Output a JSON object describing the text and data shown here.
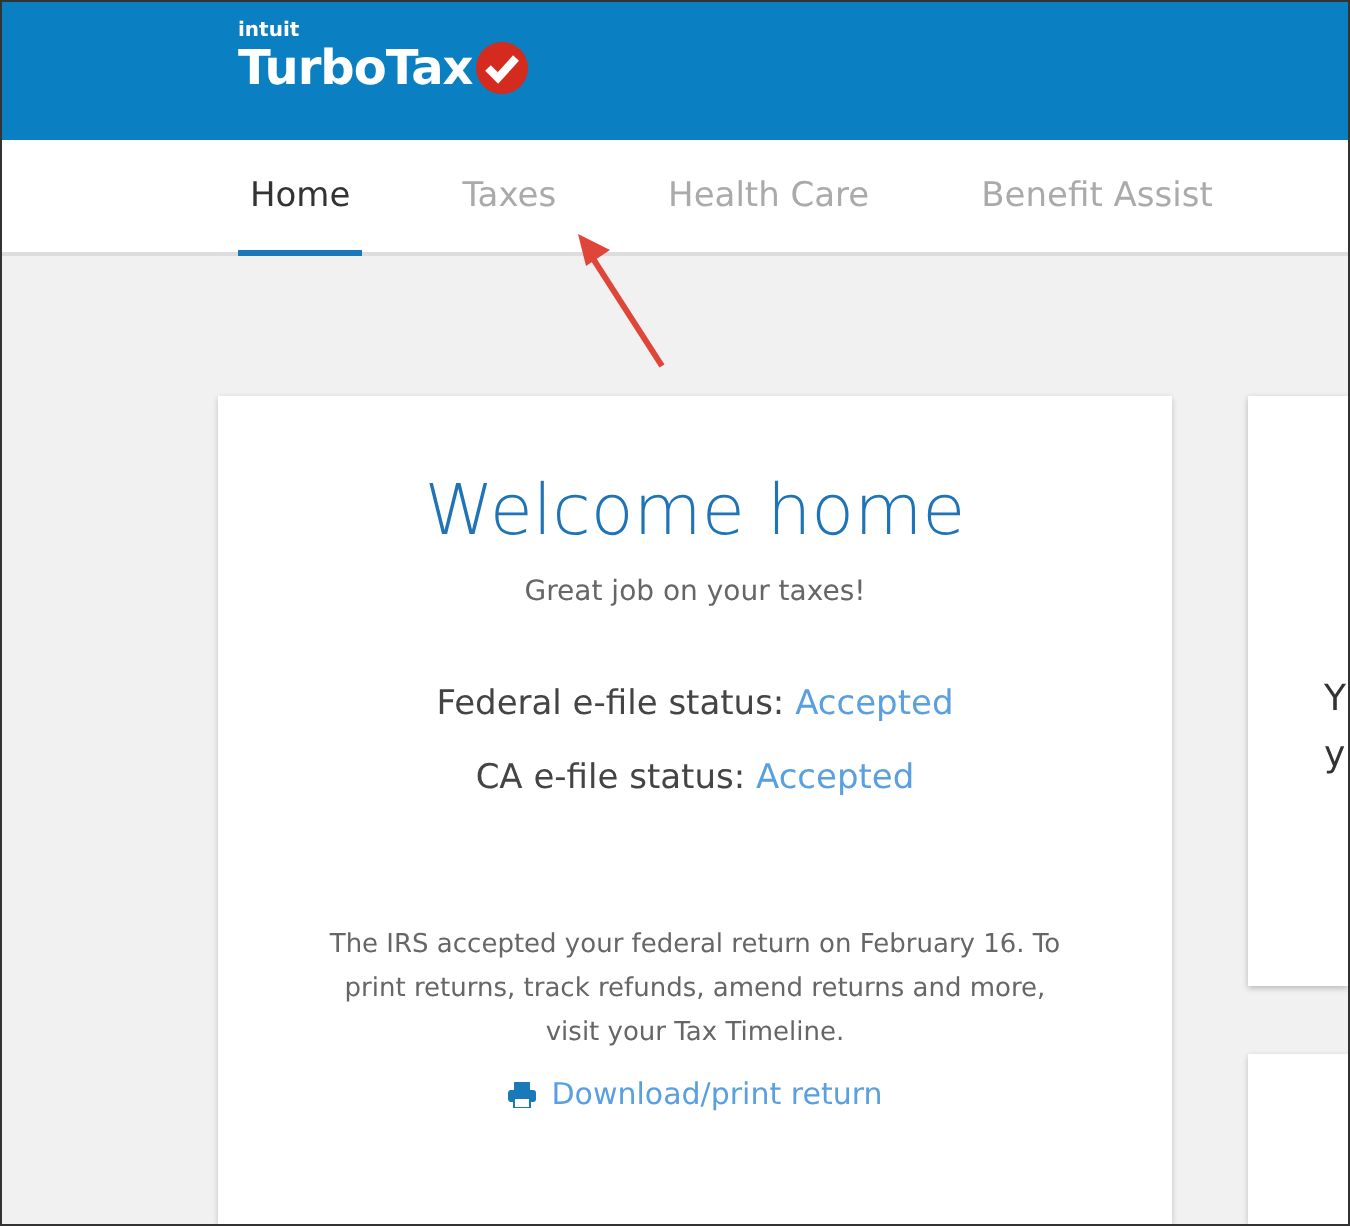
{
  "header": {
    "brand_small": "intuit",
    "brand": "TurboTax"
  },
  "tabs": [
    {
      "label": "Home",
      "selected": true
    },
    {
      "label": "Taxes",
      "selected": false
    },
    {
      "label": "Health Care",
      "selected": false
    },
    {
      "label": "Benefit Assist",
      "selected": false
    }
  ],
  "welcome_card": {
    "title": "Welcome home",
    "subtitle": "Great job on your taxes!",
    "statuses": [
      {
        "label": "Federal e-file status:",
        "value": "Accepted"
      },
      {
        "label": "CA e-file status:",
        "value": "Accepted"
      }
    ],
    "message": "The IRS accepted your federal return on February 16. To print returns, track refunds, amend returns and more, visit your Tax Timeline.",
    "link": "Download/print return"
  },
  "side_card": {
    "lines": [
      "Y",
      "y"
    ]
  }
}
